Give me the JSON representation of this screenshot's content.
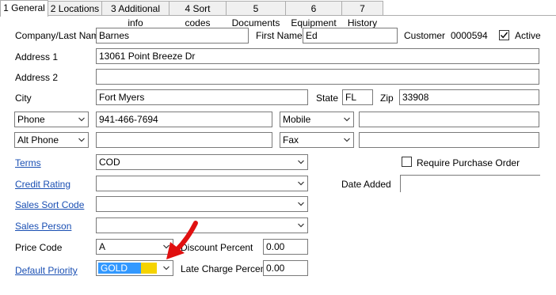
{
  "tabs": [
    {
      "label": "1 General"
    },
    {
      "label": "2 Locations"
    },
    {
      "label": "3 Additional info"
    },
    {
      "label": "4 Sort codes"
    },
    {
      "label": "5 Documents"
    },
    {
      "label": "6 Equipment"
    },
    {
      "label": "7 History"
    }
  ],
  "form": {
    "company_last_name": {
      "label": "Company/Last Name",
      "value": "Barnes"
    },
    "first_name": {
      "label": "First Name",
      "value": "Ed"
    },
    "customer": {
      "label": "Customer",
      "value": "0000594"
    },
    "active": {
      "label": "Active",
      "checked": true
    },
    "address1": {
      "label": "Address 1",
      "value": "13061 Point Breeze Dr"
    },
    "address2": {
      "label": "Address 2",
      "value": ""
    },
    "city": {
      "label": "City",
      "value": "Fort Myers"
    },
    "state": {
      "label": "State",
      "value": "FL"
    },
    "zip": {
      "label": "Zip",
      "value": "33908"
    },
    "phone1": {
      "type": "Phone",
      "value": "941-466-7694"
    },
    "phone2": {
      "type": "Mobile",
      "value": ""
    },
    "phone3": {
      "type": "Alt Phone",
      "value": ""
    },
    "phone4": {
      "type": "Fax",
      "value": ""
    },
    "terms": {
      "label": "Terms",
      "value": "COD"
    },
    "require_po": {
      "label": "Require Purchase Order",
      "checked": false
    },
    "credit_rating": {
      "label": "Credit Rating",
      "value": ""
    },
    "date_added": {
      "label": "Date Added",
      "value": ""
    },
    "sales_sort_code": {
      "label": "Sales Sort Code",
      "value": ""
    },
    "sales_person": {
      "label": "Sales Person",
      "value": ""
    },
    "price_code": {
      "label": "Price Code",
      "value": "A"
    },
    "discount_percent": {
      "label": "Discount Percent",
      "value": "0.00"
    },
    "default_priority": {
      "label": "Default Priority",
      "value": "GOLD",
      "swatch_color": "#f5d300",
      "highlight_color": "#3399ff"
    },
    "late_charge_percent": {
      "label": "Late Charge Percent",
      "value": "0.00"
    }
  },
  "annotation": {
    "color": "#e01010",
    "icon": "red-arrow-icon"
  }
}
